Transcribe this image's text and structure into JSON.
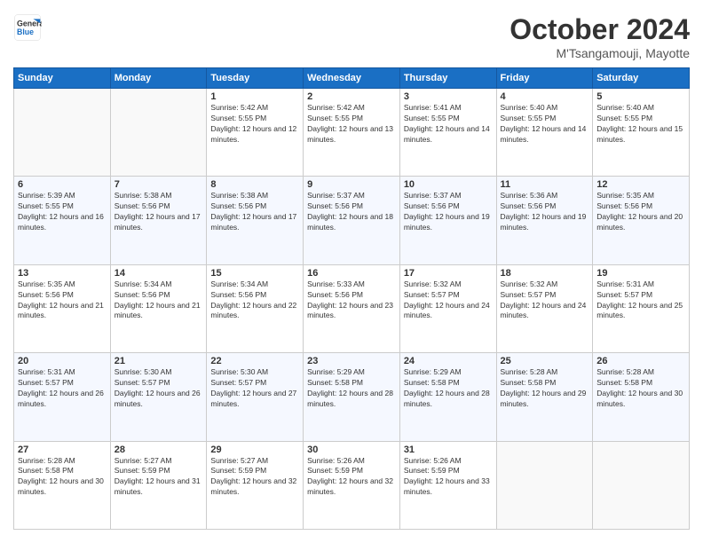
{
  "logo": {
    "line1": "General",
    "line2": "Blue"
  },
  "title": "October 2024",
  "location": "M'Tsangamouji, Mayotte",
  "days_of_week": [
    "Sunday",
    "Monday",
    "Tuesday",
    "Wednesday",
    "Thursday",
    "Friday",
    "Saturday"
  ],
  "weeks": [
    [
      {
        "day": "",
        "sunrise": "",
        "sunset": "",
        "daylight": ""
      },
      {
        "day": "",
        "sunrise": "",
        "sunset": "",
        "daylight": ""
      },
      {
        "day": "1",
        "sunrise": "Sunrise: 5:42 AM",
        "sunset": "Sunset: 5:55 PM",
        "daylight": "Daylight: 12 hours and 12 minutes."
      },
      {
        "day": "2",
        "sunrise": "Sunrise: 5:42 AM",
        "sunset": "Sunset: 5:55 PM",
        "daylight": "Daylight: 12 hours and 13 minutes."
      },
      {
        "day": "3",
        "sunrise": "Sunrise: 5:41 AM",
        "sunset": "Sunset: 5:55 PM",
        "daylight": "Daylight: 12 hours and 14 minutes."
      },
      {
        "day": "4",
        "sunrise": "Sunrise: 5:40 AM",
        "sunset": "Sunset: 5:55 PM",
        "daylight": "Daylight: 12 hours and 14 minutes."
      },
      {
        "day": "5",
        "sunrise": "Sunrise: 5:40 AM",
        "sunset": "Sunset: 5:55 PM",
        "daylight": "Daylight: 12 hours and 15 minutes."
      }
    ],
    [
      {
        "day": "6",
        "sunrise": "Sunrise: 5:39 AM",
        "sunset": "Sunset: 5:55 PM",
        "daylight": "Daylight: 12 hours and 16 minutes."
      },
      {
        "day": "7",
        "sunrise": "Sunrise: 5:38 AM",
        "sunset": "Sunset: 5:56 PM",
        "daylight": "Daylight: 12 hours and 17 minutes."
      },
      {
        "day": "8",
        "sunrise": "Sunrise: 5:38 AM",
        "sunset": "Sunset: 5:56 PM",
        "daylight": "Daylight: 12 hours and 17 minutes."
      },
      {
        "day": "9",
        "sunrise": "Sunrise: 5:37 AM",
        "sunset": "Sunset: 5:56 PM",
        "daylight": "Daylight: 12 hours and 18 minutes."
      },
      {
        "day": "10",
        "sunrise": "Sunrise: 5:37 AM",
        "sunset": "Sunset: 5:56 PM",
        "daylight": "Daylight: 12 hours and 19 minutes."
      },
      {
        "day": "11",
        "sunrise": "Sunrise: 5:36 AM",
        "sunset": "Sunset: 5:56 PM",
        "daylight": "Daylight: 12 hours and 19 minutes."
      },
      {
        "day": "12",
        "sunrise": "Sunrise: 5:35 AM",
        "sunset": "Sunset: 5:56 PM",
        "daylight": "Daylight: 12 hours and 20 minutes."
      }
    ],
    [
      {
        "day": "13",
        "sunrise": "Sunrise: 5:35 AM",
        "sunset": "Sunset: 5:56 PM",
        "daylight": "Daylight: 12 hours and 21 minutes."
      },
      {
        "day": "14",
        "sunrise": "Sunrise: 5:34 AM",
        "sunset": "Sunset: 5:56 PM",
        "daylight": "Daylight: 12 hours and 21 minutes."
      },
      {
        "day": "15",
        "sunrise": "Sunrise: 5:34 AM",
        "sunset": "Sunset: 5:56 PM",
        "daylight": "Daylight: 12 hours and 22 minutes."
      },
      {
        "day": "16",
        "sunrise": "Sunrise: 5:33 AM",
        "sunset": "Sunset: 5:56 PM",
        "daylight": "Daylight: 12 hours and 23 minutes."
      },
      {
        "day": "17",
        "sunrise": "Sunrise: 5:32 AM",
        "sunset": "Sunset: 5:57 PM",
        "daylight": "Daylight: 12 hours and 24 minutes."
      },
      {
        "day": "18",
        "sunrise": "Sunrise: 5:32 AM",
        "sunset": "Sunset: 5:57 PM",
        "daylight": "Daylight: 12 hours and 24 minutes."
      },
      {
        "day": "19",
        "sunrise": "Sunrise: 5:31 AM",
        "sunset": "Sunset: 5:57 PM",
        "daylight": "Daylight: 12 hours and 25 minutes."
      }
    ],
    [
      {
        "day": "20",
        "sunrise": "Sunrise: 5:31 AM",
        "sunset": "Sunset: 5:57 PM",
        "daylight": "Daylight: 12 hours and 26 minutes."
      },
      {
        "day": "21",
        "sunrise": "Sunrise: 5:30 AM",
        "sunset": "Sunset: 5:57 PM",
        "daylight": "Daylight: 12 hours and 26 minutes."
      },
      {
        "day": "22",
        "sunrise": "Sunrise: 5:30 AM",
        "sunset": "Sunset: 5:57 PM",
        "daylight": "Daylight: 12 hours and 27 minutes."
      },
      {
        "day": "23",
        "sunrise": "Sunrise: 5:29 AM",
        "sunset": "Sunset: 5:58 PM",
        "daylight": "Daylight: 12 hours and 28 minutes."
      },
      {
        "day": "24",
        "sunrise": "Sunrise: 5:29 AM",
        "sunset": "Sunset: 5:58 PM",
        "daylight": "Daylight: 12 hours and 28 minutes."
      },
      {
        "day": "25",
        "sunrise": "Sunrise: 5:28 AM",
        "sunset": "Sunset: 5:58 PM",
        "daylight": "Daylight: 12 hours and 29 minutes."
      },
      {
        "day": "26",
        "sunrise": "Sunrise: 5:28 AM",
        "sunset": "Sunset: 5:58 PM",
        "daylight": "Daylight: 12 hours and 30 minutes."
      }
    ],
    [
      {
        "day": "27",
        "sunrise": "Sunrise: 5:28 AM",
        "sunset": "Sunset: 5:58 PM",
        "daylight": "Daylight: 12 hours and 30 minutes."
      },
      {
        "day": "28",
        "sunrise": "Sunrise: 5:27 AM",
        "sunset": "Sunset: 5:59 PM",
        "daylight": "Daylight: 12 hours and 31 minutes."
      },
      {
        "day": "29",
        "sunrise": "Sunrise: 5:27 AM",
        "sunset": "Sunset: 5:59 PM",
        "daylight": "Daylight: 12 hours and 32 minutes."
      },
      {
        "day": "30",
        "sunrise": "Sunrise: 5:26 AM",
        "sunset": "Sunset: 5:59 PM",
        "daylight": "Daylight: 12 hours and 32 minutes."
      },
      {
        "day": "31",
        "sunrise": "Sunrise: 5:26 AM",
        "sunset": "Sunset: 5:59 PM",
        "daylight": "Daylight: 12 hours and 33 minutes."
      },
      {
        "day": "",
        "sunrise": "",
        "sunset": "",
        "daylight": ""
      },
      {
        "day": "",
        "sunrise": "",
        "sunset": "",
        "daylight": ""
      }
    ]
  ]
}
